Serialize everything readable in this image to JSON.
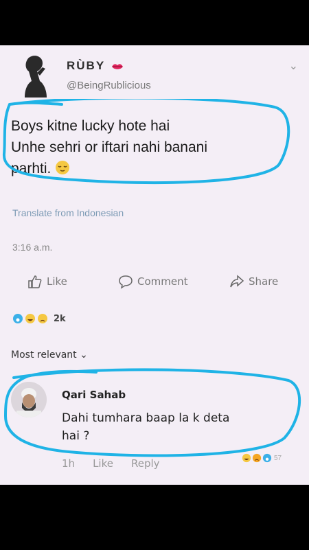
{
  "post": {
    "author_name": "RÙBY",
    "handle": "@BeingRublicious",
    "text_lines": [
      "Boys kitne lucky hote hai",
      "Unhe sehri or iftari nahi banani",
      "parhti."
    ],
    "emoji": "relieved-face",
    "translate_label": "Translate from Indonesian",
    "time": "3:16 a.m."
  },
  "actions": {
    "like": "Like",
    "comment": "Comment",
    "share": "Share"
  },
  "reactions": {
    "count": "2k",
    "icons": [
      "wow",
      "haha",
      "sad"
    ]
  },
  "sort_label": "Most relevant",
  "comment": {
    "author": "Qari Sahab",
    "text_line1": "Dahi tumhara baap la k deta",
    "text_line2": "hai ?",
    "time_short": "1h",
    "like": "Like",
    "reply": "Reply",
    "reaction_count": "57"
  },
  "colors": {
    "highlight": "#1fb3e6",
    "background": "#f4eef6",
    "link": "#7d9bb5",
    "heart": "#e0245e"
  }
}
